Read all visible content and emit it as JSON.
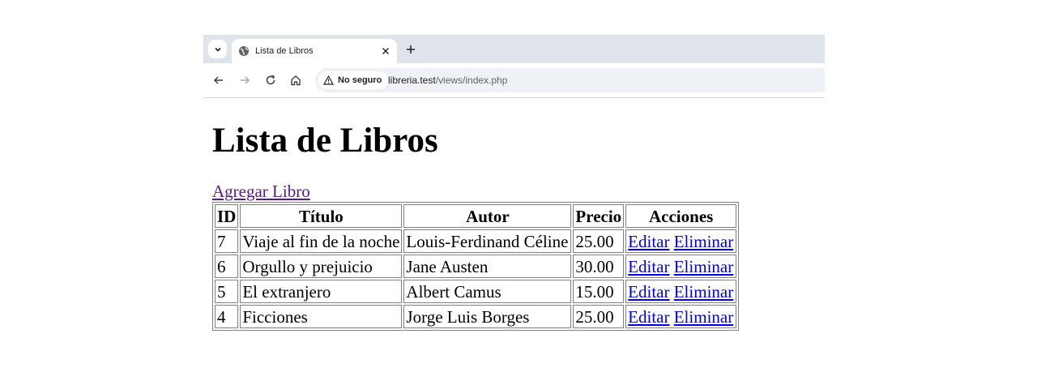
{
  "browser": {
    "tab_title": "Lista de Libros",
    "security_label": "No seguro",
    "url_host": "libreria.test",
    "url_path": "/views/index.php",
    "icons": {
      "tab_menu": "chevron-down-icon",
      "favicon": "globe-icon",
      "tab_close": "close-icon",
      "new_tab": "plus-icon",
      "back": "arrow-left-icon",
      "forward": "arrow-right-icon",
      "reload": "reload-icon",
      "home": "home-icon",
      "security": "warning-icon"
    }
  },
  "page": {
    "heading": "Lista de Libros",
    "add_link": "Agregar Libro",
    "link_color": "#0000ee",
    "visited_link_color": "#551a8b"
  },
  "table": {
    "headers": [
      "ID",
      "Título",
      "Autor",
      "Precio",
      "Acciones"
    ],
    "rows": [
      {
        "id": "7",
        "titulo": "Viaje al fin de la noche",
        "autor": "Louis-Ferdinand Céline",
        "precio": "25.00",
        "editar": "Editar",
        "eliminar": "Eliminar"
      },
      {
        "id": "6",
        "titulo": "Orgullo y prejuicio",
        "autor": "Jane Austen",
        "precio": "30.00",
        "editar": "Editar",
        "eliminar": "Eliminar"
      },
      {
        "id": "5",
        "titulo": "El extranjero",
        "autor": "Albert Camus",
        "precio": "15.00",
        "editar": "Editar",
        "eliminar": "Eliminar"
      },
      {
        "id": "4",
        "titulo": "Ficciones",
        "autor": "Jorge Luis Borges",
        "precio": "25.00",
        "editar": "Editar",
        "eliminar": "Eliminar"
      }
    ]
  }
}
